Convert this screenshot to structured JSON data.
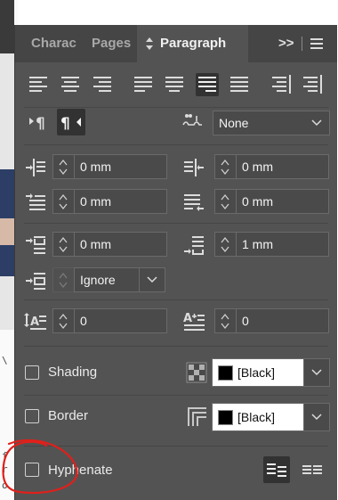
{
  "tabs": [
    {
      "label": "Charac",
      "active": false
    },
    {
      "label": "Pages",
      "active": false
    },
    {
      "label": "Paragraph",
      "active": true
    }
  ],
  "tab_icons": {
    "paragraph_prefix": "diamond-arrows-icon",
    "more": ">>",
    "menu": "hamburger-icon"
  },
  "alignment": {
    "buttons": [
      "align-left",
      "align-center",
      "align-right",
      "justify-left",
      "justify-center",
      "justify-right",
      "justify-all",
      "align-towards-spine",
      "align-away-from-spine"
    ],
    "selected": "justify-right"
  },
  "direction": {
    "buttons": [
      "ltr",
      "rtl"
    ],
    "selected": "rtl"
  },
  "kashida": {
    "icon": "kashida-icon",
    "value": "None"
  },
  "indents": {
    "left_indent": "0 mm",
    "right_indent": "0 mm",
    "first_line_indent": "0 mm",
    "last_line_indent": "0 mm",
    "space_before": "0 mm",
    "space_after": "1 mm"
  },
  "grid_align": {
    "value": "Ignore"
  },
  "drop_cap": {
    "lines": "0",
    "chars": "0"
  },
  "shading": {
    "label": "Shading",
    "checked": false,
    "color": "[Black]"
  },
  "border": {
    "label": "Border",
    "checked": false,
    "color": "[Black]"
  },
  "hyphenate": {
    "label": "Hyphenate",
    "checked": false
  },
  "colors": {
    "panel": "#535353",
    "tabbar": "#454545",
    "field": "#4a4a4a",
    "annotation": "#e0201a"
  }
}
